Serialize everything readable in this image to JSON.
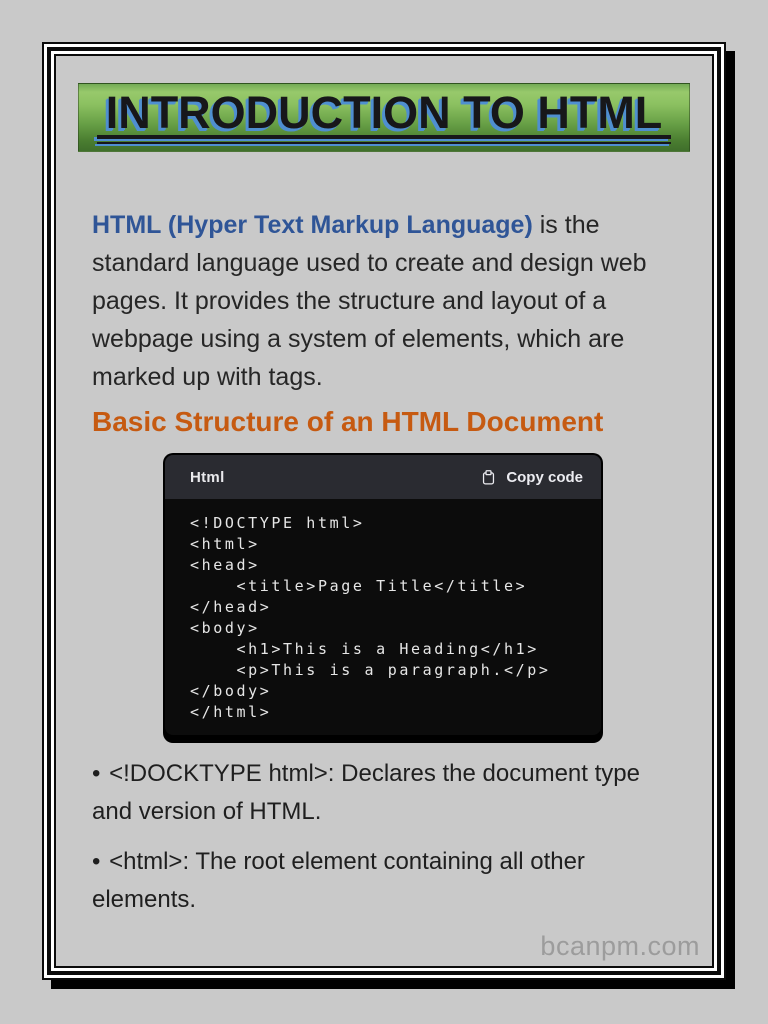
{
  "banner": {
    "title": "INTRODUCTION TO HTML"
  },
  "intro": {
    "lead": "HTML (Hyper Text Markup Language)",
    "rest": " is the\nstandard language used to create and design web\npages. It provides the structure and layout of a\nwebpage using a system of elements, which are\nmarked up with tags."
  },
  "section": {
    "heading": "Basic Structure of an HTML Document"
  },
  "code_block": {
    "language_label": "Html",
    "copy_button_label": "Copy code",
    "copy_icon": "clipboard-icon",
    "code": "<!DOCTYPE html>\n<html>\n<head>\n    <title>Page Title</title>\n</head>\n<body>\n    <h1>This is a Heading</h1>\n    <p>This is a paragraph.</p>\n</body>\n</html>"
  },
  "bullets": {
    "marker": "•",
    "items": [
      {
        "text": "<!DOCKTYPE html>: Declares the document type\nand version of HTML."
      },
      {
        "text": "<html>: The root element containing all other\nelements."
      }
    ]
  },
  "page": {
    "watermark": "bcanpm.com"
  },
  "colors": {
    "page_background": "#c9c9c9",
    "accent_blue_text": "#2f5597",
    "accent_orange_heading": "#c65a11",
    "banner_green_light": "#97c96b",
    "banner_green_dark": "#3f6f2b",
    "banner_blue_outline": "#4f8fd0",
    "code_header_bg": "#2a2b31",
    "code_body_bg": "#0c0c0c",
    "code_text": "#e6e6e6",
    "watermark_gray": "#9c9c9c"
  }
}
